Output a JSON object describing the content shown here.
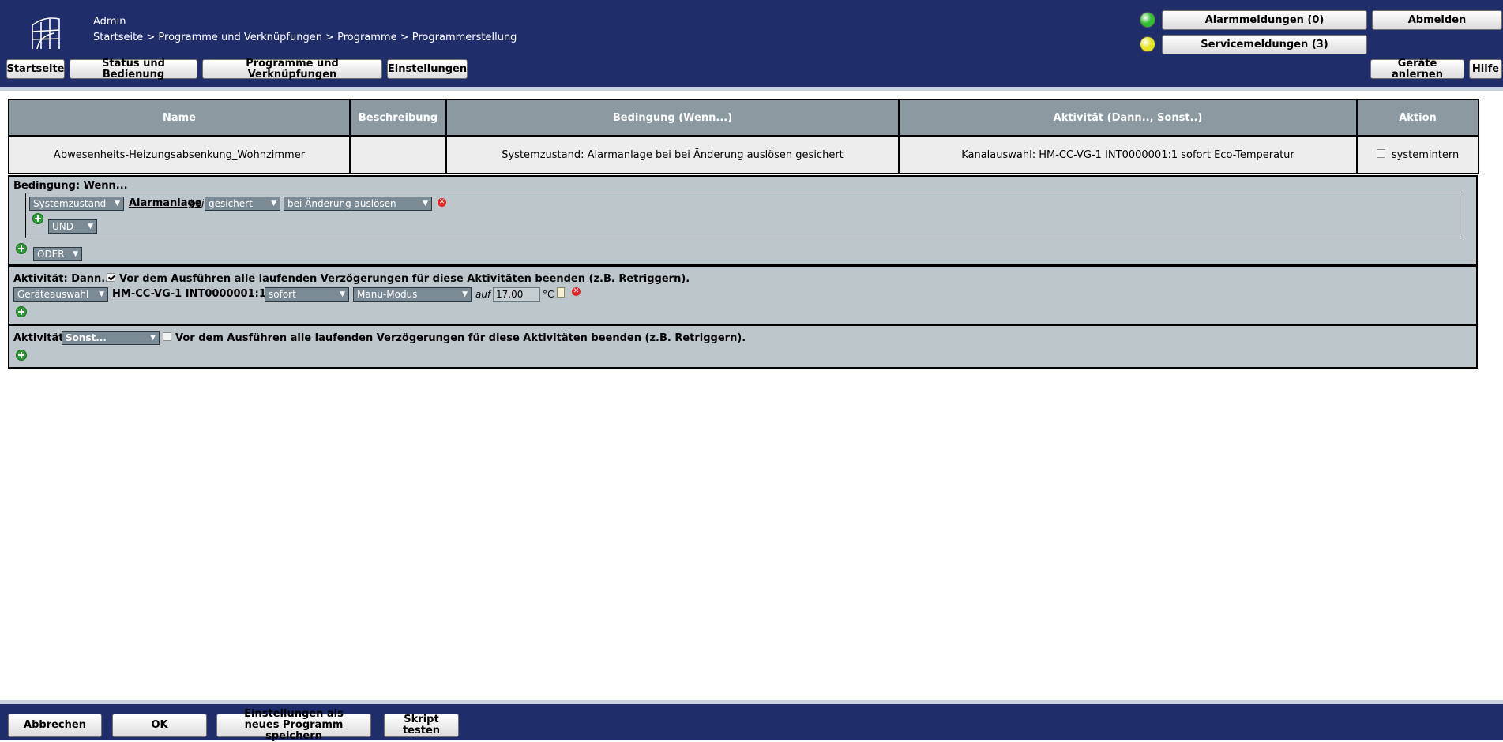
{
  "header": {
    "user": "Admin",
    "breadcrumb": "Startseite > Programme und Verknüpfungen > Programme > Programmerstellung",
    "alarm_button": "Alarmmeldungen (0)",
    "service_button": "Servicemeldungen (3)",
    "logout_button": "Abmelden",
    "alarm_status_color": "#2fbf2f",
    "service_status_color": "#e6e620",
    "nav": [
      "Startseite",
      "Status und Bedienung",
      "Programme und Verknüpfungen",
      "Einstellungen"
    ],
    "learn_button": "Geräte anlernen",
    "help_button": "Hilfe"
  },
  "program_table": {
    "columns": [
      "Name",
      "Beschreibung",
      "Bedingung (Wenn...)",
      "Aktivität (Dann.., Sonst..)",
      "Aktion"
    ],
    "row": {
      "name": "Abwesenheits-Heizungsabsenkung_Wohnzimmer",
      "description": "",
      "condition": "Systemzustand: Alarmanlage bei bei Änderung auslösen gesichert",
      "activity": "Kanalauswahl: HM-CC-VG-1 INT0000001:1 sofort Eco-Temperatur",
      "action_label": "systemintern",
      "action_checked": false
    }
  },
  "condition": {
    "heading": "Bedingung: Wenn...",
    "type_select": "Systemzustand",
    "object_link": "Alarmanlage",
    "bei_text": "bei",
    "state_select": "gesichert",
    "trigger_select": "bei Änderung auslösen",
    "and_select": "UND",
    "or_select": "ODER"
  },
  "then_activity": {
    "heading": "Aktivität: Dann...",
    "stop_delays_checked": true,
    "stop_delays_label": "Vor dem Ausführen alle laufenden Verzögerungen für diese Aktivitäten beenden (z.B. Retriggern).",
    "device_select": "Geräteauswahl",
    "device_link": "HM-CC-VG-1 INT0000001:1",
    "timing_select": "sofort",
    "mode_select": "Manu-Modus",
    "auf_text": "auf",
    "value": "17.00",
    "unit": "°C"
  },
  "else_activity": {
    "heading": "Aktivität:",
    "else_select": "Sonst...",
    "stop_delays_checked": false,
    "stop_delays_label": "Vor dem Ausführen alle laufenden Verzögerungen für diese Aktivitäten beenden (z.B. Retriggern)."
  },
  "footer": {
    "cancel": "Abbrechen",
    "ok": "OK",
    "save_as_new": "Einstellungen als neues Programm speichern",
    "test_script": "Skript testen"
  }
}
